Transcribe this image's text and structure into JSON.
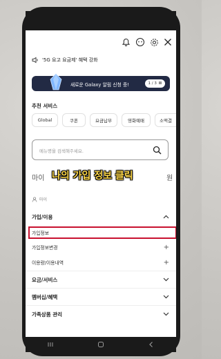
{
  "announcement": {
    "text": "'5G 요고 요금제' 혜택 강화"
  },
  "banner": {
    "text": "새로운 Galaxy 알림 신청 중!",
    "pager": "1 / 3",
    "pause": "II"
  },
  "recommend": {
    "title": "추천 서비스",
    "chips": [
      "Global",
      "쿠폰",
      "요금납부",
      "영화예매",
      "소액결"
    ]
  },
  "search": {
    "placeholder": "메뉴명을 검색해주세요."
  },
  "menu_tabs": {
    "left": "마이",
    "right": "원"
  },
  "overlay": {
    "text": "나의 가입 정보 클릭"
  },
  "section_label": "마이",
  "menu": {
    "join_use": "가입/이용",
    "join_info": "가입정보",
    "join_info_change": "가입정보변경",
    "usage": "이용량/이용내역",
    "plan_service": "요금/서비스",
    "membership": "멤버십/혜택",
    "family": "가족상품 관리"
  },
  "colors": {
    "highlight": "#c8102e",
    "overlay_text": "#ffd84a",
    "banner_bg": "#222a44"
  }
}
